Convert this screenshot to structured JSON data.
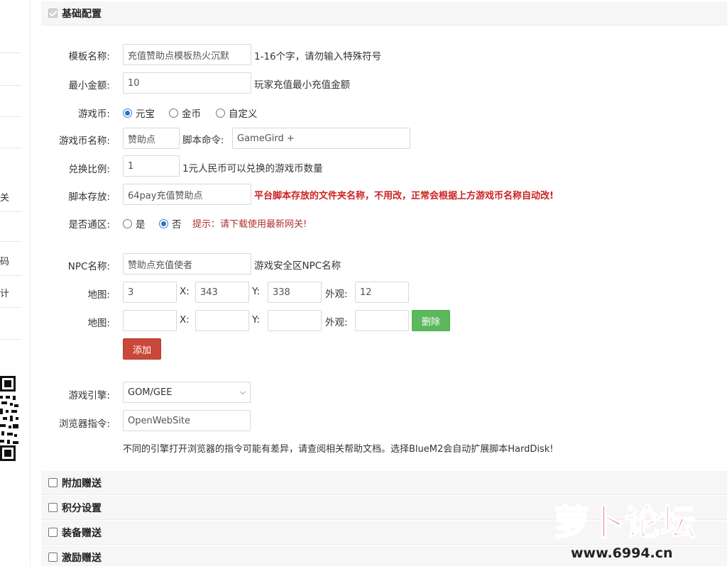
{
  "sidebar": {
    "fragments": [
      "网关",
      "代码",
      "统计"
    ]
  },
  "sections": {
    "basic": "基础配置",
    "extra": "附加赠送",
    "points": "积分设置",
    "equip": "装备赠送",
    "incentive": "激励赠送"
  },
  "form": {
    "template_name": {
      "label": "模板名称:",
      "value": "充值赞助点模板热火沉默",
      "hint": "1-16个字，请勿输入特殊符号"
    },
    "min_amount": {
      "label": "最小金额:",
      "value": "10",
      "hint": "玩家充值最小充值金额"
    },
    "currency": {
      "label": "游戏币:",
      "options": [
        "元宝",
        "金币",
        "自定义"
      ],
      "selected": "元宝"
    },
    "currency_name": {
      "label": "游戏币名称:",
      "value": "赞助点",
      "script_label": "脚本命令:",
      "script_value": "GameGird +"
    },
    "ratio": {
      "label": "兑换比例:",
      "value": "1",
      "hint": "1元人民币可以兑换的游戏币数量"
    },
    "script_dir": {
      "label": "脚本存放:",
      "value": "64pay充值赞助点",
      "hint": "平台脚本存放的文件夹名称，不用改，正常会根据上方游戏币名称自动改!"
    },
    "cross_zone": {
      "label": "是否通区:",
      "options": [
        "是",
        "否"
      ],
      "selected": "否",
      "tip": "提示：请下载使用最新网关!"
    },
    "npc_name": {
      "label": "NPC名称:",
      "value": "赞助点充值使者",
      "hint": "游戏安全区NPC名称"
    },
    "map_rows": [
      {
        "label": "地图:",
        "map": "3",
        "x_label": "X:",
        "x": "343",
        "y_label": "Y:",
        "y": "338",
        "look_label": "外观:",
        "look": "12"
      },
      {
        "label": "地图:",
        "map": "",
        "x_label": "X:",
        "x": "",
        "y_label": "Y:",
        "y": "",
        "look_label": "外观:",
        "look": "",
        "delete_label": "删除"
      }
    ],
    "add_label": "添加",
    "engine": {
      "label": "游戏引擎:",
      "value": "GOM/GEE"
    },
    "browser_cmd": {
      "label": "浏览器指令:",
      "value": "OpenWebSite",
      "note": "不同的引擎打开浏览器的指令可能有差异，请查阅相关帮助文档。选择BlueM2会自动扩展脚本HardDisk!"
    }
  },
  "watermark": {
    "text": "萝卜论坛",
    "url": "www.6994.cn"
  }
}
